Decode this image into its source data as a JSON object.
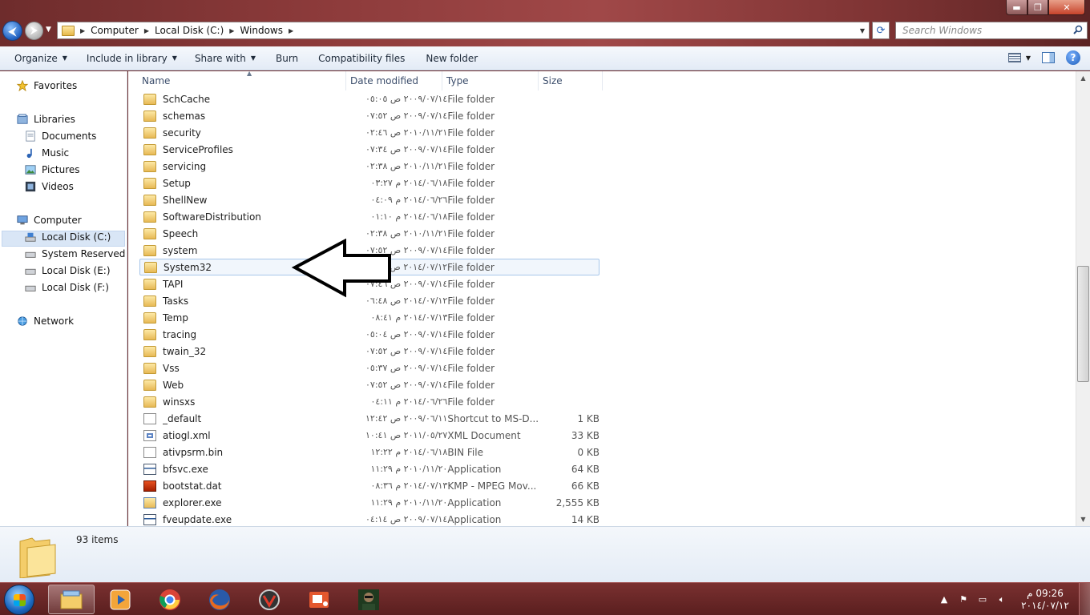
{
  "address": {
    "crumbs": [
      "Computer",
      "Local Disk (C:)",
      "Windows"
    ]
  },
  "search": {
    "placeholder": "Search Windows"
  },
  "toolbar": {
    "organize": "Organize",
    "include_in_library": "Include in library",
    "share_with": "Share with",
    "burn": "Burn",
    "compatibility_files": "Compatibility files",
    "new_folder": "New folder"
  },
  "nav": {
    "favorites": "Favorites",
    "libraries": "Libraries",
    "documents": "Documents",
    "music": "Music",
    "pictures": "Pictures",
    "videos": "Videos",
    "computer": "Computer",
    "local_c": "Local Disk (C:)",
    "system_reserved": "System Reserved (D:",
    "local_e": "Local Disk (E:)",
    "local_f": "Local Disk (F:)",
    "network": "Network"
  },
  "columns": {
    "name": "Name",
    "date": "Date modified",
    "type": "Type",
    "size": "Size"
  },
  "files": [
    {
      "name": "SchCache",
      "date": "٢٠٠٩/٠٧/١٤ ص ٠٥:٠٥",
      "type": "File folder",
      "size": "",
      "icon": "folder-icon"
    },
    {
      "name": "schemas",
      "date": "٢٠٠٩/٠٧/١٤ ص ٠٧:٥٢",
      "type": "File folder",
      "size": "",
      "icon": "folder-icon"
    },
    {
      "name": "security",
      "date": "٢٠١٠/١١/٢١ ص ٠٢:٤٦",
      "type": "File folder",
      "size": "",
      "icon": "folder-icon"
    },
    {
      "name": "ServiceProfiles",
      "date": "٢٠٠٩/٠٧/١٤ ص ٠٧:٣٤",
      "type": "File folder",
      "size": "",
      "icon": "folder-icon"
    },
    {
      "name": "servicing",
      "date": "٢٠١٠/١١/٢١ ص ٠٢:٣٨",
      "type": "File folder",
      "size": "",
      "icon": "folder-icon"
    },
    {
      "name": "Setup",
      "date": "٢٠١٤/٠٦/١٨ م ٠٣:٢٧",
      "type": "File folder",
      "size": "",
      "icon": "folder-icon"
    },
    {
      "name": "ShellNew",
      "date": "٢٠١٤/٠٦/٢٦ م ٠٤:٠٩",
      "type": "File folder",
      "size": "",
      "icon": "folder-icon"
    },
    {
      "name": "SoftwareDistribution",
      "date": "٢٠١٤/٠٦/١٨ م ٠١:١٠",
      "type": "File folder",
      "size": "",
      "icon": "folder-icon"
    },
    {
      "name": "Speech",
      "date": "٢٠١٠/١١/٢١ ص ٠٢:٣٨",
      "type": "File folder",
      "size": "",
      "icon": "folder-icon"
    },
    {
      "name": "system",
      "date": "٢٠٠٩/٠٧/١٤ ص ٠٧:٥٢",
      "type": "File folder",
      "size": "",
      "icon": "folder-icon"
    },
    {
      "name": "System32",
      "date": "٢٠١٤/٠٧/١٢ ص ٠٢:٠٤",
      "type": "File folder",
      "size": "",
      "icon": "folder-icon",
      "selected": true
    },
    {
      "name": "TAPI",
      "date": "٢٠٠٩/٠٧/١٤ ص ٠٧:٤٦",
      "type": "File folder",
      "size": "",
      "icon": "folder-icon"
    },
    {
      "name": "Tasks",
      "date": "٢٠١٤/٠٧/١٢ ص ٠٦:٤٨",
      "type": "File folder",
      "size": "",
      "icon": "folder-icon"
    },
    {
      "name": "Temp",
      "date": "٢٠١٤/٠٧/١٣ م ٠٨:٤١",
      "type": "File folder",
      "size": "",
      "icon": "folder-icon"
    },
    {
      "name": "tracing",
      "date": "٢٠٠٩/٠٧/١٤ ص ٠٥:٠٤",
      "type": "File folder",
      "size": "",
      "icon": "folder-icon"
    },
    {
      "name": "twain_32",
      "date": "٢٠٠٩/٠٧/١٤ ص ٠٧:٥٢",
      "type": "File folder",
      "size": "",
      "icon": "folder-icon"
    },
    {
      "name": "Vss",
      "date": "٢٠٠٩/٠٧/١٤ ص ٠٥:٣٧",
      "type": "File folder",
      "size": "",
      "icon": "folder-icon"
    },
    {
      "name": "Web",
      "date": "٢٠٠٩/٠٧/١٤ ص ٠٧:٥٢",
      "type": "File folder",
      "size": "",
      "icon": "folder-icon"
    },
    {
      "name": "winsxs",
      "date": "٢٠١٤/٠٦/٢٦ م ٠٤:١١",
      "type": "File folder",
      "size": "",
      "icon": "folder-icon"
    },
    {
      "name": "_default",
      "date": "٢٠٠٩/٠٦/١١ ص ١٢:٤٢",
      "type": "Shortcut to MS-D...",
      "size": "1 KB",
      "icon": "shortcut-icon"
    },
    {
      "name": "atiogl.xml",
      "date": "٢٠١١/٠٥/٢٧ ص ١٠:٤١",
      "type": "XML Document",
      "size": "33 KB",
      "icon": "xml-icon"
    },
    {
      "name": "ativpsrm.bin",
      "date": "٢٠١٤/٠٦/١٨ م ١٢:٢٢",
      "type": "BIN File",
      "size": "0 KB",
      "icon": "file-icon"
    },
    {
      "name": "bfsvc.exe",
      "date": "٢٠١٠/١١/٢٠ م ١١:٢٩",
      "type": "Application",
      "size": "64 KB",
      "icon": "app-icon"
    },
    {
      "name": "bootstat.dat",
      "date": "٢٠١٤/٠٧/١٣ م ٠٨:٣٦",
      "type": "KMP - MPEG Mov...",
      "size": "66 KB",
      "icon": "kmp-icon"
    },
    {
      "name": "explorer.exe",
      "date": "٢٠١٠/١١/٢٠ م ١١:٢٩",
      "type": "Application",
      "size": "2,555 KB",
      "icon": "explorer-icon"
    },
    {
      "name": "fveupdate.exe",
      "date": "٢٠٠٩/٠٧/١٤ ص ٠٤:١٤",
      "type": "Application",
      "size": "14 KB",
      "icon": "app-icon"
    }
  ],
  "status": {
    "item_count": "93 items"
  },
  "clock": {
    "time": "09:26 م",
    "date": "٢٠١٤/٠٧/١٢"
  },
  "colors": {
    "selection_border": "#a7c6ea",
    "selection_fill": "#f1f6fc",
    "taskbar": "#6b2a2a"
  }
}
